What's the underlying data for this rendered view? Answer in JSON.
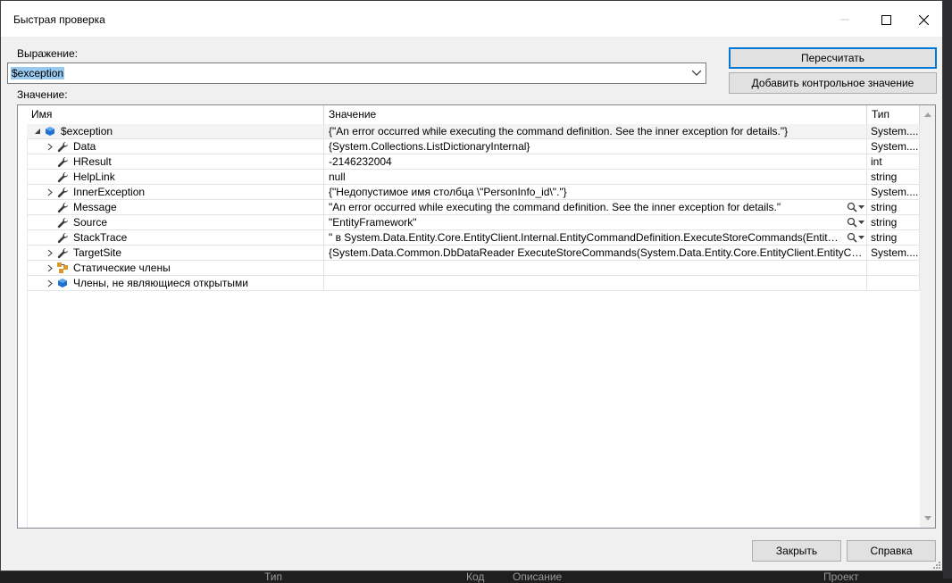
{
  "window": {
    "title": "Быстрая проверка"
  },
  "expression": {
    "label": "Выражение:",
    "value": "$exception"
  },
  "value_label": "Значение:",
  "buttons": {
    "recalculate": "Пересчитать",
    "add_watch": "Добавить контрольное значение",
    "close": "Закрыть",
    "help": "Справка"
  },
  "grid": {
    "columns": [
      "Имя",
      "Значение",
      "Тип"
    ],
    "rows": [
      {
        "name": "$exception",
        "value": "{\"An error occurred while executing the command definition. See the inner exception for details.\"}",
        "type": "System....",
        "icon": "object-icon",
        "expander": "expanded"
      },
      {
        "name": "Data",
        "value": "{System.Collections.ListDictionaryInternal}",
        "type": "System....",
        "icon": "wrench-icon",
        "expander": "collapsed"
      },
      {
        "name": "HResult",
        "value": "-2146232004",
        "type": "int",
        "icon": "wrench-icon",
        "expander": "none"
      },
      {
        "name": "HelpLink",
        "value": "null",
        "type": "string",
        "icon": "wrench-icon",
        "expander": "none"
      },
      {
        "name": "InnerException",
        "value": "{\"Недопустимое имя столбца \\\"PersonInfo_id\\\".\"}",
        "type": "System....",
        "icon": "wrench-icon",
        "expander": "collapsed"
      },
      {
        "name": "Message",
        "value": "\"An error occurred while executing the command definition. See the inner exception for details.\"",
        "type": "string",
        "icon": "wrench-icon",
        "expander": "none",
        "magnifier": true
      },
      {
        "name": "Source",
        "value": "\"EntityFramework\"",
        "type": "string",
        "icon": "wrench-icon",
        "expander": "none",
        "magnifier": true
      },
      {
        "name": "StackTrace",
        "value": "\"   в System.Data.Entity.Core.EntityClient.Internal.EntityCommandDefinition.ExecuteStoreCommands(EntityComm",
        "type": "string",
        "icon": "wrench-icon",
        "expander": "none",
        "magnifier": true
      },
      {
        "name": "TargetSite",
        "value": "{System.Data.Common.DbDataReader ExecuteStoreCommands(System.Data.Entity.Core.EntityClient.EntityComma",
        "type": "System....",
        "icon": "wrench-icon",
        "expander": "collapsed"
      },
      {
        "name": "Статические члены",
        "value": "",
        "type": "",
        "icon": "static-members-icon",
        "expander": "collapsed"
      },
      {
        "name": "Члены, не являющиеся открытыми",
        "value": "",
        "type": "",
        "icon": "non-public-members-icon",
        "expander": "collapsed"
      }
    ]
  },
  "background": {
    "left_text": "Тип",
    "mid_text_1": "Код",
    "mid_text_2": "Описание",
    "right_text": "Проект"
  },
  "colors": {
    "accent": "#0078d7",
    "selection": "#99c9ef",
    "object_icon": "#1e6fd0"
  }
}
